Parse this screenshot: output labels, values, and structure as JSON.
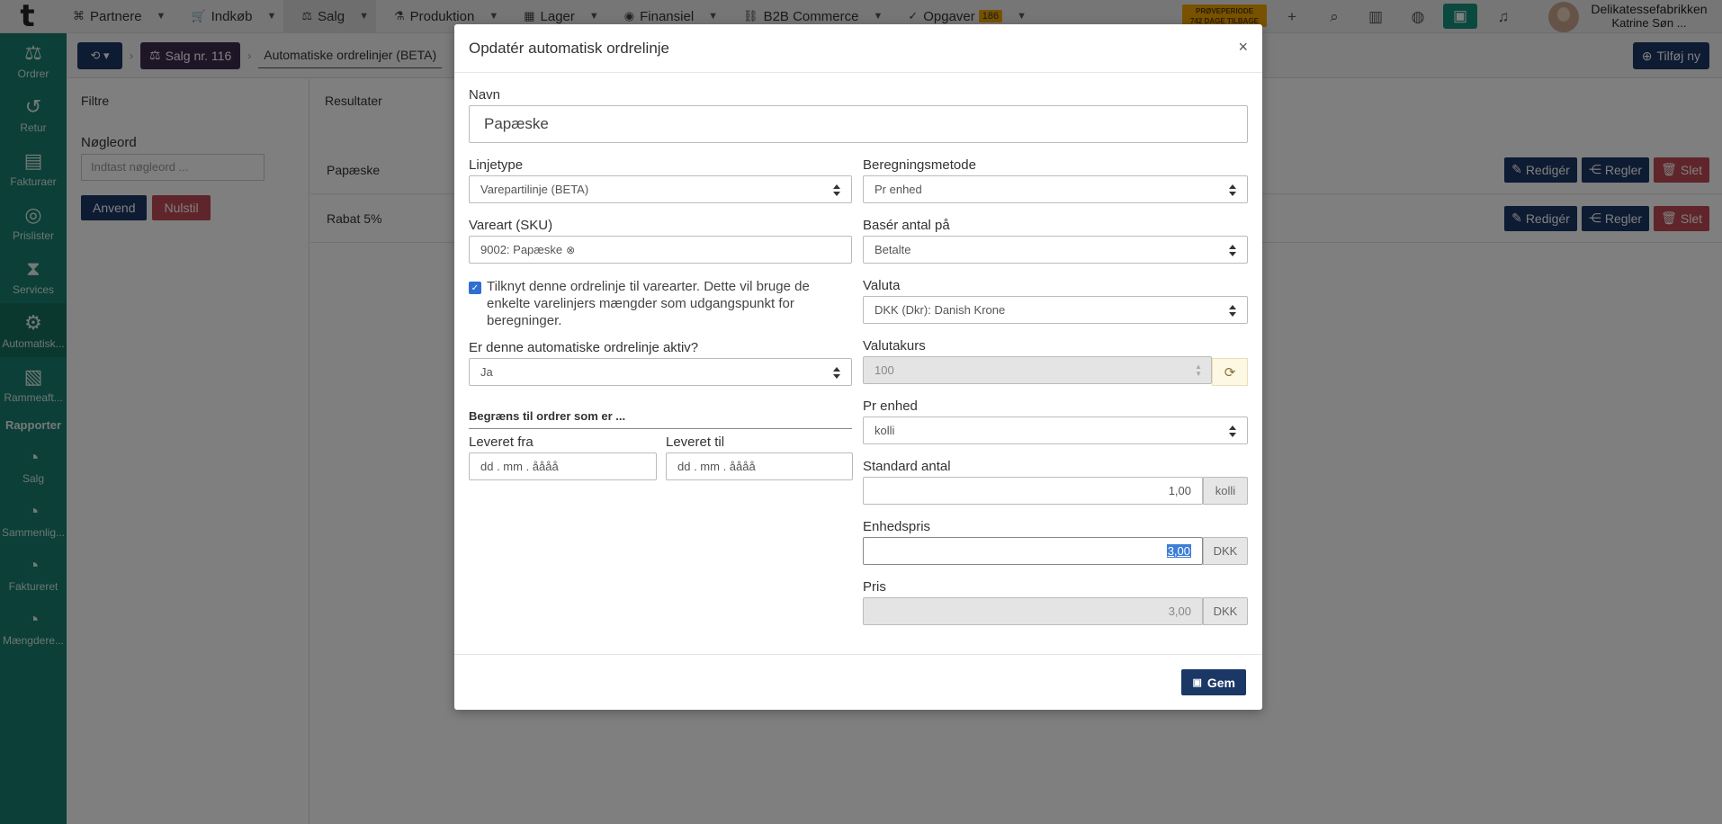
{
  "topnav": {
    "logo": "t",
    "items": [
      {
        "label": "Partnere",
        "icon": "⌘"
      },
      {
        "label": "Indkøb",
        "icon": "🛒"
      },
      {
        "label": "Salg",
        "icon": "⚖"
      },
      {
        "label": "Produktion",
        "icon": "⚗"
      },
      {
        "label": "Lager",
        "icon": "▦"
      },
      {
        "label": "Finansiel",
        "icon": "◉"
      },
      {
        "label": "B2B Commerce",
        "icon": "⛓"
      },
      {
        "label": "Opgaver",
        "icon": "✓",
        "badge": "186"
      }
    ],
    "trial_line1": "PRØVEPERIODE",
    "trial_line2": "742 DAGE TILBAGE",
    "company": "Delikatessefabrikken",
    "user": "Katrine Søn ..."
  },
  "sidebar": {
    "items": [
      {
        "label": "Ordrer",
        "icon": "⚖"
      },
      {
        "label": "Retur",
        "icon": "↺"
      },
      {
        "label": "Fakturaer",
        "icon": "▤"
      },
      {
        "label": "Prislister",
        "icon": "◎"
      },
      {
        "label": "Services",
        "icon": "⧗"
      },
      {
        "label": "Automatisk...",
        "icon": "⚙"
      },
      {
        "label": "Rammeaft...",
        "icon": "▧"
      }
    ],
    "reports_heading": "Rapporter",
    "reports": [
      {
        "label": "Salg",
        "icon": "◔"
      },
      {
        "label": "Sammenlig...",
        "icon": "◔"
      },
      {
        "label": "Faktureret",
        "icon": "◔"
      },
      {
        "label": "Mængdere...",
        "icon": "◔"
      }
    ]
  },
  "page": {
    "crumb1": "Salg nr. 116",
    "crumb2": "Automatiske ordrelinjer (BETA)",
    "add_new": "Tilføj ny",
    "filters_title": "Filtre",
    "keyword_label": "Nøgleord",
    "keyword_placeholder": "Indtast nøgleord ...",
    "apply": "Anvend",
    "reset": "Nulstil",
    "results_title": "Resultater",
    "rows": [
      {
        "name": "Papæske"
      },
      {
        "name": "Rabat 5%"
      }
    ],
    "edit": "Redigér",
    "rules": "Regler",
    "delete": "Slet"
  },
  "modal": {
    "title": "Opdatér automatisk ordrelinje",
    "close": "×",
    "name_label": "Navn",
    "name_value": "Papæske",
    "linetype_label": "Linjetype",
    "linetype_value": "Varepartilinje (BETA)",
    "calc_label": "Beregningsmetode",
    "calc_value": "Pr enhed",
    "sku_label": "Vareart (SKU)",
    "sku_value": "9002: Papæske",
    "base_label": "Basér antal på",
    "base_value": "Betalte",
    "checkbox_checked": true,
    "checkbox_text": "Tilknyt denne ordrelinje til varearter. Dette vil bruge de enkelte varelinjers mængder som udgangspunkt for beregninger.",
    "currency_label": "Valuta",
    "currency_value": "DKK (Dkr): Danish Krone",
    "active_label": "Er denne automatiske ordrelinje aktiv?",
    "active_value": "Ja",
    "rate_label": "Valutakurs",
    "rate_value": "100",
    "limit_title": "Begræns til ordrer som er ...",
    "from_label": "Leveret fra",
    "to_label": "Leveret til",
    "date_placeholder": "dd . mm . åååå",
    "unit_label": "Pr enhed",
    "unit_value": "kolli",
    "std_label": "Standard antal",
    "std_value": "1,00",
    "std_unit": "kolli",
    "unitprice_label": "Enhedspris",
    "unitprice_value": "3,00",
    "unitprice_currency": "DKK",
    "price_label": "Pris",
    "price_value": "3,00",
    "price_currency": "DKK",
    "save": "Gem"
  }
}
